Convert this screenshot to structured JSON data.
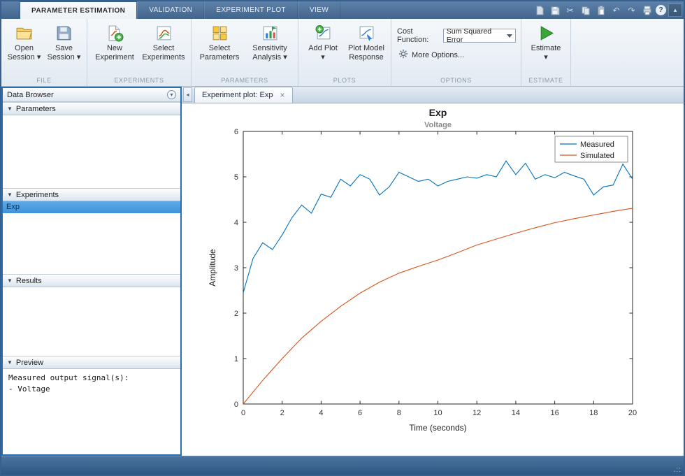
{
  "tabstrip": {
    "tabs": [
      {
        "label": "PARAMETER ESTIMATION",
        "active": true
      },
      {
        "label": "VALIDATION",
        "active": false
      },
      {
        "label": "EXPERIMENT PLOT",
        "active": false
      },
      {
        "label": "VIEW",
        "active": false
      }
    ]
  },
  "icons": {
    "cut": "✂",
    "undo": "↶",
    "redo": "↷",
    "help": "?",
    "minimize_toolstrip": "▴",
    "panel_menu": "▾",
    "section_expanded": "▼",
    "collapse_left": "◂",
    "close": "×",
    "grip": ".::"
  },
  "ribbon": {
    "file": {
      "label": "FILE",
      "open_session": "Open\nSession ▾",
      "save_session": "Save\nSession ▾"
    },
    "experiments": {
      "label": "EXPERIMENTS",
      "new_experiment": "New\nExperiment",
      "select_experiments": "Select\nExperiments"
    },
    "parameters": {
      "label": "PARAMETERS",
      "select_parameters": "Select\nParameters",
      "sensitivity_analysis": "Sensitivity\nAnalysis ▾"
    },
    "plots": {
      "label": "PLOTS",
      "add_plot": "Add Plot\n▾",
      "plot_model_response": "Plot Model\nResponse"
    },
    "options": {
      "label": "OPTIONS",
      "cost_function_label": "Cost Function:",
      "cost_function_value": "Sum Squared Error",
      "more_options": "More Options..."
    },
    "estimate": {
      "label": "ESTIMATE",
      "estimate_button": "Estimate\n▾"
    }
  },
  "data_browser": {
    "title": "Data Browser",
    "sections": {
      "parameters": {
        "label": "Parameters",
        "items": []
      },
      "experiments": {
        "label": "Experiments",
        "items": [
          {
            "name": "Exp",
            "selected": true
          }
        ]
      },
      "results": {
        "label": "Results",
        "items": []
      },
      "preview": {
        "label": "Preview",
        "text": "Measured output signal(s):\n  - Voltage"
      }
    }
  },
  "document": {
    "tab_label": "Experiment plot: Exp"
  },
  "colors": {
    "measured": "#0072BD",
    "simulated": "#D95319",
    "selection": "#4D9BE0"
  },
  "chart_data": {
    "type": "line",
    "title": "Exp",
    "subtitle": "Voltage",
    "xlabel": "Time (seconds)",
    "ylabel": "Amplitude",
    "xlim": [
      0,
      20
    ],
    "ylim": [
      0,
      6
    ],
    "xticks": [
      0,
      2,
      4,
      6,
      8,
      10,
      12,
      14,
      16,
      18,
      20
    ],
    "yticks": [
      0,
      1,
      2,
      3,
      4,
      5,
      6
    ],
    "grid": false,
    "legend": [
      "Measured",
      "Simulated"
    ],
    "legend_position": "top-right",
    "series": [
      {
        "name": "Measured",
        "color": "#0072BD",
        "x": [
          0,
          0.5,
          1,
          1.5,
          2,
          2.5,
          3,
          3.5,
          4,
          4.5,
          5,
          5.5,
          6,
          6.5,
          7,
          7.5,
          8,
          8.5,
          9,
          9.5,
          10,
          10.5,
          11,
          11.5,
          12,
          12.5,
          13,
          13.5,
          14,
          14.5,
          15,
          15.5,
          16,
          16.5,
          17,
          17.5,
          18,
          18.5,
          19,
          19.5,
          20
        ],
        "y": [
          2.45,
          3.2,
          3.55,
          3.4,
          3.72,
          4.1,
          4.38,
          4.2,
          4.62,
          4.55,
          4.95,
          4.8,
          5.05,
          4.95,
          4.6,
          4.78,
          5.1,
          5.0,
          4.9,
          4.95,
          4.8,
          4.9,
          4.95,
          5.0,
          4.97,
          5.05,
          5.0,
          5.35,
          5.05,
          5.3,
          4.95,
          5.05,
          4.98,
          5.1,
          5.02,
          4.95,
          4.6,
          4.78,
          4.82,
          5.28,
          4.95
        ]
      },
      {
        "name": "Simulated",
        "color": "#D95319",
        "x": [
          0,
          1,
          2,
          3,
          4,
          5,
          6,
          7,
          8,
          9,
          10,
          11,
          12,
          13,
          14,
          15,
          16,
          17,
          18,
          19,
          20
        ],
        "y": [
          0,
          0.52,
          1.0,
          1.45,
          1.82,
          2.15,
          2.44,
          2.68,
          2.88,
          3.03,
          3.17,
          3.33,
          3.5,
          3.63,
          3.76,
          3.88,
          3.99,
          4.08,
          4.16,
          4.24,
          4.31
        ]
      }
    ]
  }
}
